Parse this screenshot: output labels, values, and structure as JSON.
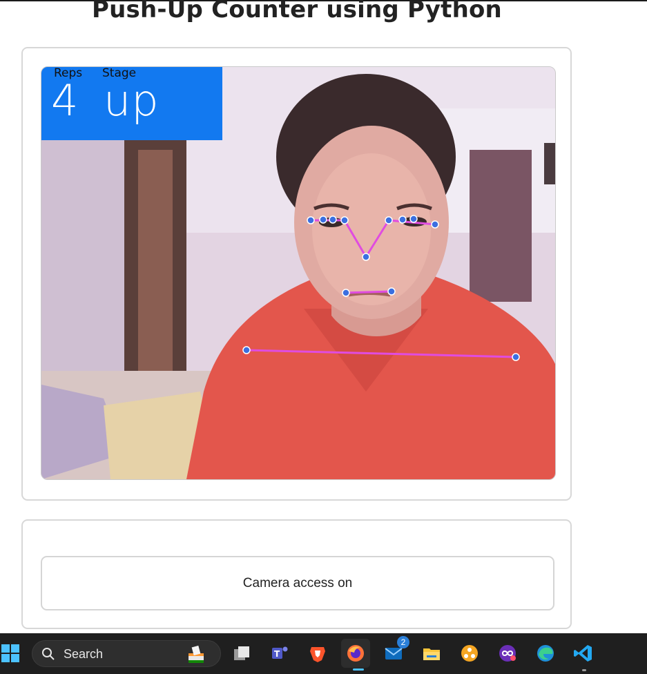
{
  "page": {
    "title": "Push-Up Counter using Python"
  },
  "hud": {
    "reps_label": "Reps",
    "stage_label": "Stage",
    "reps_value": "4",
    "stage_value": "up"
  },
  "status": {
    "label": "Camera access on"
  },
  "taskbar": {
    "search_placeholder": "Search",
    "mail_badge": "2",
    "apps": [
      "start-icon",
      "search-icon",
      "task-view-icon",
      "teams-icon",
      "brave-icon",
      "firefox-icon",
      "mail-icon",
      "file-explorer-icon",
      "app-icon",
      "infinity-app-icon",
      "edge-icon",
      "vscode-icon"
    ]
  },
  "colors": {
    "hud_background": "#1279f0",
    "landmark_line": "#e04ce0",
    "landmark_point": "#3b6fe0",
    "taskbar": "#1f1f1f"
  }
}
